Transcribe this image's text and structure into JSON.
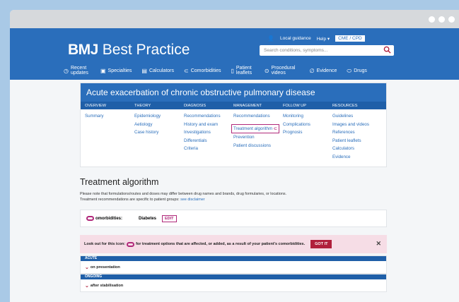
{
  "brand": {
    "logo_bold": "BMJ",
    "logo_light": "Best Practice"
  },
  "toplinks": {
    "local_guidance": "Local guidance",
    "help": "Help",
    "cme": "CME / CPD"
  },
  "search": {
    "placeholder": "Search conditions, symptoms..."
  },
  "nav": [
    {
      "label": "Recent updates",
      "icon": "clock-icon"
    },
    {
      "label": "Specialties",
      "icon": "briefcase-icon"
    },
    {
      "label": "Calculators",
      "icon": "calculator-icon"
    },
    {
      "label": "Comorbidities",
      "icon": "comorbidity-icon"
    },
    {
      "label": "Patient leaflets",
      "icon": "leaflet-icon"
    },
    {
      "label": "Procedural videos",
      "icon": "play-icon"
    },
    {
      "label": "Evidence",
      "icon": "evidence-icon"
    },
    {
      "label": "Drugs",
      "icon": "pill-icon"
    }
  ],
  "topic": {
    "title": "Acute exacerbation of chronic obstructive pulmonary disease",
    "columns": [
      {
        "head": "OVERVIEW",
        "links": [
          "Summary"
        ]
      },
      {
        "head": "THEORY",
        "links": [
          "Epidemiology",
          "Aetiology",
          "Case history"
        ]
      },
      {
        "head": "DIAGNOSIS",
        "links": [
          "Recommendations",
          "History and exam",
          "Investigations",
          "Differentials",
          "Criteria"
        ]
      },
      {
        "head": "MANAGEMENT",
        "links": [
          "Recommendations",
          "Treatment algorithm",
          "Prevention",
          "Patient discussions"
        ]
      },
      {
        "head": "FOLLOW UP",
        "links": [
          "Monitoring",
          "Complications",
          "Prognosis"
        ]
      },
      {
        "head": "RESOURCES",
        "links": [
          "Guidelines",
          "Images and videos",
          "References",
          "Patient leaflets",
          "Calculators",
          "Evidence"
        ]
      }
    ]
  },
  "main": {
    "heading": "Treatment algorithm",
    "note": "Please note that formulations/routes and doses may differ between drug names and brands, drug formularies, or locations. Treatment recommendations are specific to patient groups:",
    "note_link": "see disclaimer",
    "comorbidities_label": "omorbidities:",
    "comorbidity": "Diabetes",
    "edit": "EDIT",
    "alert_pre": "Look out for this icon:",
    "alert_post": "for treatment options that are affected, or added, as a result of your patient's comorbidities.",
    "got_it": "GOT IT",
    "sections": [
      {
        "head": "ACUTE",
        "row": "on presentation"
      },
      {
        "head": "ONGOING",
        "row": "after stabilisation"
      }
    ]
  },
  "colors": {
    "brand_blue": "#2a6ebb",
    "accent_magenta": "#b0287a",
    "alert_pink": "#f6dde6"
  }
}
